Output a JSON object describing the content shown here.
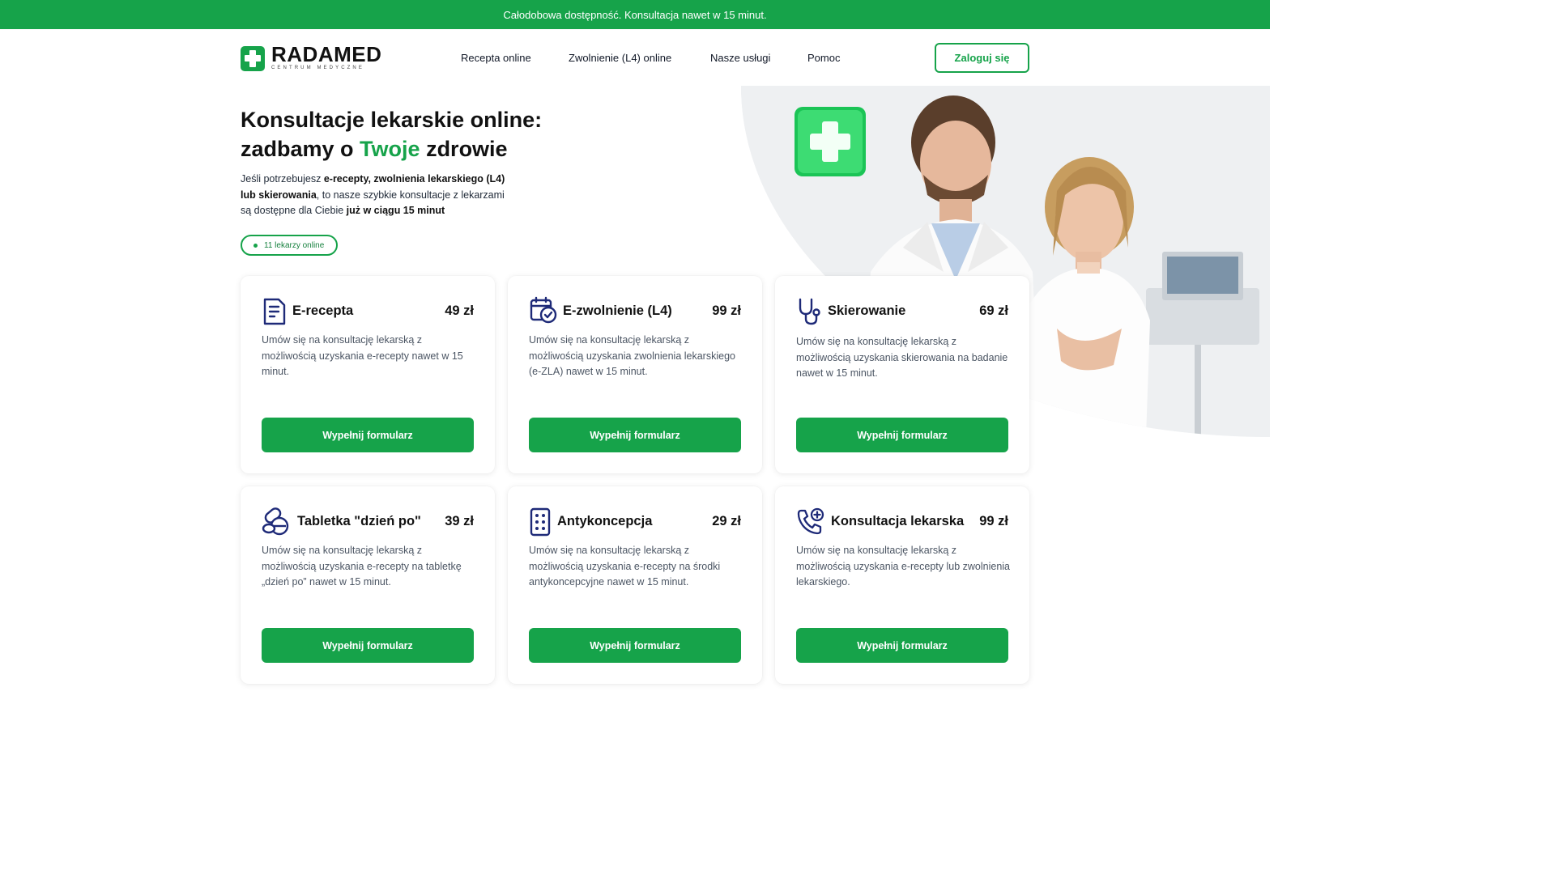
{
  "topbar": {
    "text": "Całodobowa dostępność. Konsultacja nawet w 15 minut."
  },
  "brand": {
    "name": "RADAMED",
    "tagline": "CENTRUM MEDYCZNE",
    "color": "#16a34a"
  },
  "nav": {
    "items": [
      {
        "label": "Recepta online"
      },
      {
        "label": "Zwolnienie (L4) online"
      },
      {
        "label": "Nasze usługi"
      },
      {
        "label": "Pomoc"
      }
    ],
    "login_label": "Zaloguj się"
  },
  "hero": {
    "title_line1": "Konsultacje lekarskie online:",
    "title_line2_pre": "zadbamy o ",
    "title_line2_accent": "Twoje",
    "title_line2_post": " zdrowie",
    "desc": {
      "p1": "Jeśli potrzebujesz ",
      "b1": "e-recepty, zwolnienia lekarskiego (L4) lub skierowania",
      "p2": ", to nasze szybkie konsultacje z lekarzami są dostępne dla Ciebie ",
      "b2": "już w ciągu 15 minut"
    },
    "online_badge": "11 lekarzy online"
  },
  "cards": [
    {
      "icon": "prescription-document-icon",
      "title": "E-recepta",
      "price": "49 zł",
      "desc": "Umów się na konsultację lekarską z możliwością uzyskania e-recepty nawet w 15 minut.",
      "button": "Wypełnij formularz"
    },
    {
      "icon": "calendar-check-icon",
      "title": "E-zwolnienie (L4)",
      "price": "99 zł",
      "desc": "Umów się na konsultację lekarską z możliwością uzyskania zwolnienia lekarskiego (e-ZLA) nawet w 15 minut.",
      "button": "Wypełnij formularz"
    },
    {
      "icon": "stethoscope-icon",
      "title": "Skierowanie",
      "price": "69 zł",
      "desc": "Umów się na konsultację lekarską z możliwością uzyskania skierowania na badanie nawet w 15 minut.",
      "button": "Wypełnij formularz"
    },
    {
      "icon": "pills-icon",
      "title": "Tabletka \"dzień po\"",
      "price": "39 zł",
      "desc": "Umów się na konsultację lekarską z możliwością uzyskania e-recepty na tabletkę „dzień po” nawet w 15 minut.",
      "button": "Wypełnij formularz"
    },
    {
      "icon": "pill-blister-icon",
      "title": "Antykoncepcja",
      "price": "29 zł",
      "desc": "Umów się na konsultację lekarską z możliwością uzyskania e-recepty na środki antykoncepcyjne nawet w 15 minut.",
      "button": "Wypełnij formularz"
    },
    {
      "icon": "phone-plus-icon",
      "title": "Konsultacja lekarska",
      "price": "99 zł",
      "desc": "Umów się na konsultację lekarską z możliwością uzyskania e-recepty lub zwolnienia lekarskiego.",
      "button": "Wypełnij formularz"
    }
  ]
}
